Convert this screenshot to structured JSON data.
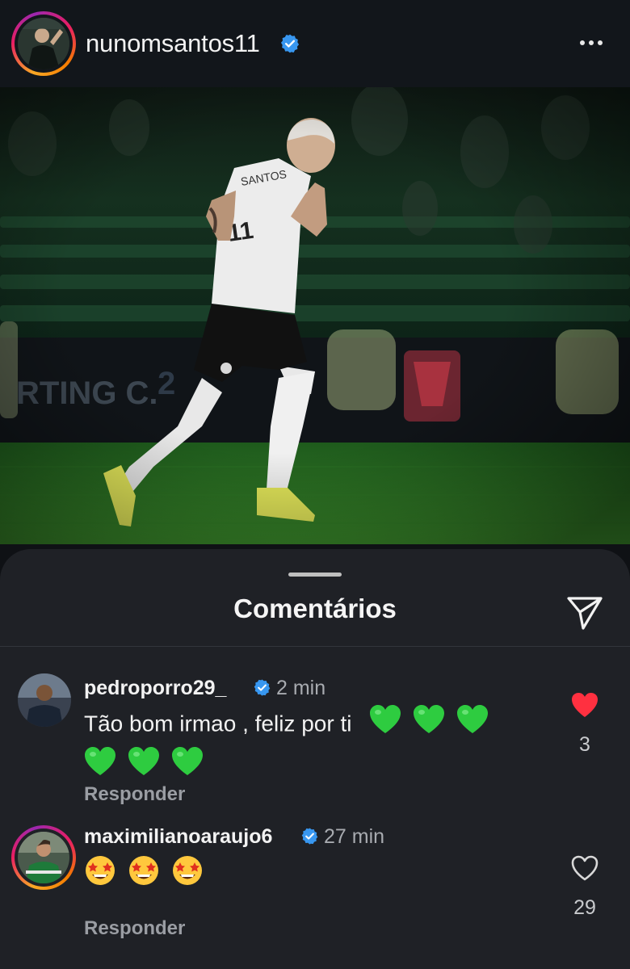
{
  "post": {
    "username": "nunomsantos11",
    "verified": true
  },
  "sheet": {
    "title": "Comentários"
  },
  "comments": [
    {
      "username": "pedroporro29_",
      "verified": true,
      "time": "2 min",
      "text": "Tão bom irmao , feliz por ti",
      "emojis": [
        "green-heart",
        "green-heart",
        "green-heart",
        "green-heart",
        "green-heart",
        "green-heart"
      ],
      "reply_label": "Responder",
      "liked": true,
      "like_count": "3"
    },
    {
      "username": "maximilianoaraujo6",
      "verified": true,
      "time": "27 min",
      "text": "",
      "emojis": [
        "star-struck",
        "star-struck",
        "star-struck"
      ],
      "reply_label": "Responder",
      "liked": false,
      "like_count": "29"
    }
  ],
  "colors": {
    "verified_blue": "#3897f0",
    "like_red": "#ff3040",
    "green_heart": "#2ecc40",
    "sheet_bg": "#1f2126"
  }
}
